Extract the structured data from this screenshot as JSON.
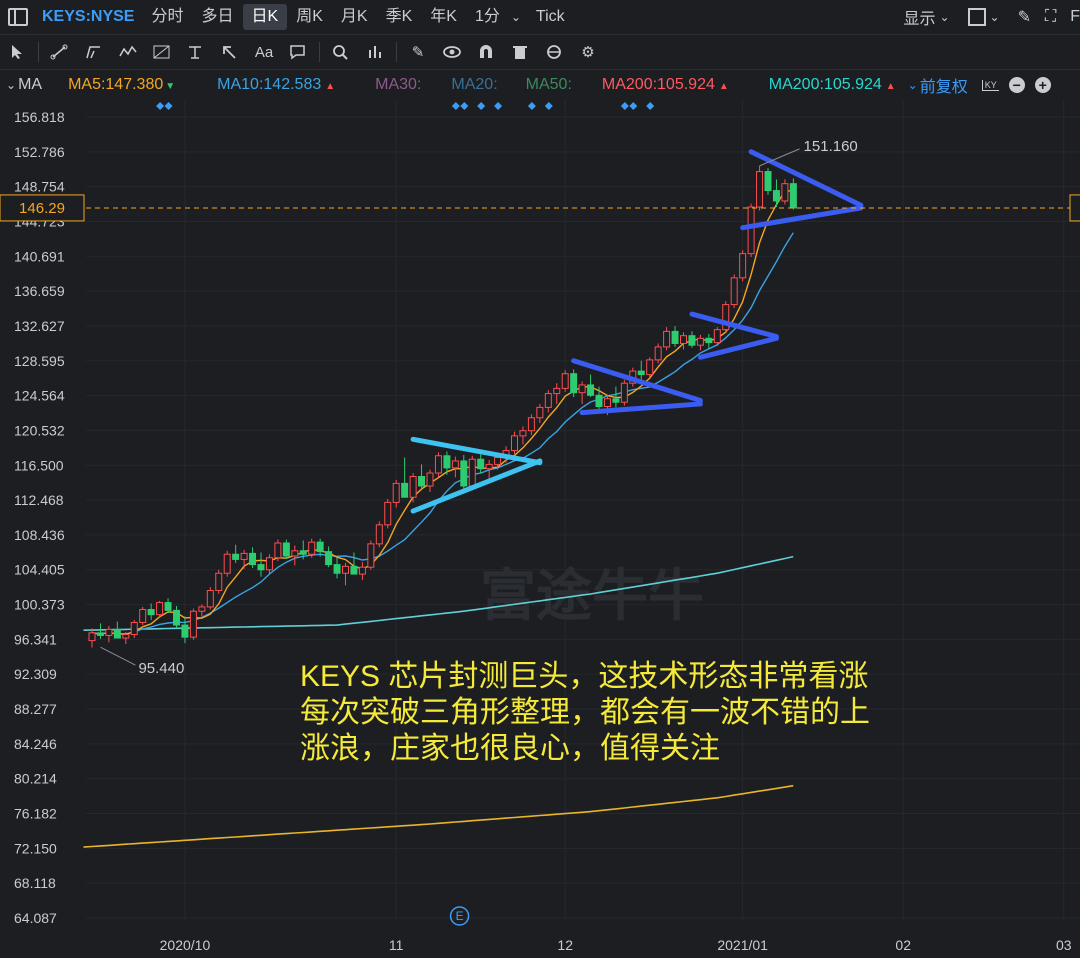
{
  "header": {
    "symbol": "KEYS:NYSE",
    "tabs": [
      "分时",
      "多日",
      "日K",
      "周K",
      "月K",
      "季K",
      "年K",
      "1分"
    ],
    "active_tab": "日K",
    "tick_label": "Tick",
    "display_label": "显示"
  },
  "toolbar": {
    "icons": [
      "cursor-icon",
      "line-draw-icon",
      "channel-draw-icon",
      "wave-draw-icon",
      "fib-draw-icon",
      "hline-draw-icon",
      "arrow-draw-icon",
      "text-tool-icon",
      "comment-icon",
      "zoom-icon",
      "pattern-icon",
      "pen-icon",
      "eye-icon",
      "magnet-icon",
      "trash-icon",
      "sync-icon",
      "settings-icon"
    ],
    "text_tool_label": "Aa"
  },
  "ma_legend": {
    "prefix": "MA",
    "items": [
      {
        "label": "MA5:147.380",
        "color": "#f5a623",
        "arrow": "▼",
        "arrow_color": "#2ecc71"
      },
      {
        "label": "MA10:142.583",
        "color": "#3aa3e3",
        "arrow": "▲",
        "arrow_color": "#ff4d4f"
      },
      {
        "label": "MA30:",
        "color": "#8e5a8c",
        "arrow": "",
        "arrow_color": ""
      },
      {
        "label": "MA20:",
        "color": "#3a6f96",
        "arrow": "",
        "arrow_color": ""
      },
      {
        "label": "MA50:",
        "color": "#3d8a5e",
        "arrow": "",
        "arrow_color": ""
      },
      {
        "label": "MA200:105.924",
        "color": "#ff5a5f",
        "arrow": "▲",
        "arrow_color": "#ff4d4f"
      },
      {
        "label": "MA200:105.924",
        "color": "#28d7d0",
        "arrow": "▲",
        "arrow_color": "#ff4d4f"
      }
    ],
    "adjust_label": "前复权",
    "kx_label": "KY"
  },
  "chart_data": {
    "type": "candlestick",
    "y_ticks": [
      156.818,
      152.786,
      148.754,
      144.723,
      140.691,
      136.659,
      132.627,
      128.595,
      124.564,
      120.532,
      116.5,
      112.468,
      108.436,
      104.405,
      100.373,
      96.341,
      92.309,
      88.277,
      84.246,
      80.214,
      76.182,
      72.15,
      68.118,
      64.087
    ],
    "ylim": [
      64.087,
      156.818
    ],
    "x_ticks": [
      {
        "label": "2020/10",
        "day": 11
      },
      {
        "label": "11",
        "day": 36
      },
      {
        "label": "12",
        "day": 56
      },
      {
        "label": "2021/01",
        "day": 77
      },
      {
        "label": "02",
        "day": 96
      },
      {
        "label": "03",
        "day": 115
      }
    ],
    "current_price": 146.29,
    "max_label": "151.160",
    "min_label": "95.440",
    "ohlc": [
      [
        96.2,
        97.6,
        95.4,
        97.1
      ],
      [
        97.1,
        98.2,
        96.4,
        96.8
      ],
      [
        96.8,
        97.9,
        96.0,
        97.5
      ],
      [
        97.5,
        98.4,
        96.9,
        96.5
      ],
      [
        96.5,
        97.2,
        95.8,
        96.9
      ],
      [
        96.9,
        98.6,
        96.5,
        98.3
      ],
      [
        98.3,
        100.1,
        98.0,
        99.8
      ],
      [
        99.8,
        100.5,
        98.6,
        99.2
      ],
      [
        99.2,
        100.8,
        98.9,
        100.6
      ],
      [
        100.6,
        101.1,
        99.4,
        99.7
      ],
      [
        99.7,
        100.2,
        97.6,
        98.0
      ],
      [
        98.0,
        99.0,
        95.9,
        96.6
      ],
      [
        96.6,
        99.9,
        96.3,
        99.6
      ],
      [
        99.6,
        100.4,
        99.0,
        100.1
      ],
      [
        100.1,
        102.4,
        99.8,
        102.0
      ],
      [
        102.0,
        104.4,
        101.6,
        104.0
      ],
      [
        104.0,
        106.6,
        103.6,
        106.2
      ],
      [
        106.2,
        107.3,
        105.2,
        105.6
      ],
      [
        105.6,
        106.7,
        104.5,
        106.3
      ],
      [
        106.3,
        107.0,
        104.6,
        105.0
      ],
      [
        105.0,
        106.4,
        103.6,
        104.4
      ],
      [
        104.4,
        106.2,
        103.9,
        105.8
      ],
      [
        105.8,
        107.9,
        105.4,
        107.5
      ],
      [
        107.5,
        107.9,
        105.7,
        106.0
      ],
      [
        106.0,
        107.2,
        104.9,
        106.6
      ],
      [
        106.6,
        107.8,
        105.6,
        106.2
      ],
      [
        106.2,
        108.0,
        105.8,
        107.6
      ],
      [
        107.6,
        108.0,
        105.9,
        106.5
      ],
      [
        106.5,
        107.1,
        104.7,
        105.0
      ],
      [
        105.0,
        105.8,
        103.4,
        104.0
      ],
      [
        104.0,
        105.2,
        102.6,
        104.8
      ],
      [
        104.8,
        106.4,
        104.2,
        103.9
      ],
      [
        103.9,
        105.3,
        103.2,
        104.7
      ],
      [
        104.7,
        107.8,
        104.4,
        107.4
      ],
      [
        107.4,
        110.0,
        107.0,
        109.6
      ],
      [
        109.6,
        112.6,
        109.2,
        112.2
      ],
      [
        112.2,
        114.8,
        111.6,
        114.4
      ],
      [
        114.4,
        117.4,
        113.9,
        112.8
      ],
      [
        112.8,
        115.6,
        112.2,
        115.2
      ],
      [
        115.2,
        116.6,
        113.6,
        114.1
      ],
      [
        114.1,
        116.0,
        113.4,
        115.6
      ],
      [
        115.6,
        118.0,
        115.1,
        117.6
      ],
      [
        117.6,
        118.1,
        115.4,
        116.2
      ],
      [
        116.2,
        117.5,
        115.1,
        117.0
      ],
      [
        117.0,
        117.7,
        113.7,
        114.1
      ],
      [
        114.1,
        117.6,
        113.6,
        117.2
      ],
      [
        117.2,
        118.0,
        115.6,
        116.1
      ],
      [
        116.1,
        117.1,
        114.9,
        116.6
      ],
      [
        116.6,
        117.7,
        116.0,
        117.4
      ],
      [
        117.4,
        118.7,
        116.8,
        118.2
      ],
      [
        118.2,
        120.4,
        117.8,
        119.9
      ],
      [
        119.9,
        121.0,
        118.9,
        120.5
      ],
      [
        120.5,
        122.4,
        120.0,
        122.0
      ],
      [
        122.0,
        123.6,
        121.4,
        123.2
      ],
      [
        123.2,
        125.2,
        122.6,
        124.8
      ],
      [
        124.8,
        126.0,
        123.6,
        125.4
      ],
      [
        125.4,
        127.5,
        125.0,
        127.1
      ],
      [
        127.1,
        127.6,
        124.4,
        124.9
      ],
      [
        124.9,
        126.2,
        123.6,
        125.8
      ],
      [
        125.8,
        127.0,
        124.4,
        124.6
      ],
      [
        124.6,
        125.6,
        122.8,
        123.3
      ],
      [
        123.3,
        124.7,
        122.3,
        124.2
      ],
      [
        124.2,
        125.6,
        123.2,
        123.8
      ],
      [
        123.8,
        126.4,
        123.4,
        126.0
      ],
      [
        126.0,
        127.8,
        125.6,
        127.4
      ],
      [
        127.4,
        128.6,
        126.2,
        127.0
      ],
      [
        127.0,
        129.0,
        126.6,
        128.7
      ],
      [
        128.7,
        130.6,
        128.3,
        130.2
      ],
      [
        130.2,
        132.5,
        129.8,
        132.0
      ],
      [
        132.0,
        132.6,
        130.2,
        130.6
      ],
      [
        130.6,
        131.9,
        129.9,
        131.5
      ],
      [
        131.5,
        132.0,
        130.1,
        130.4
      ],
      [
        130.4,
        131.6,
        129.8,
        131.2
      ],
      [
        131.2,
        131.7,
        130.0,
        130.7
      ],
      [
        130.7,
        132.5,
        130.3,
        132.2
      ],
      [
        132.2,
        135.5,
        131.8,
        135.1
      ],
      [
        135.1,
        138.6,
        134.7,
        138.2
      ],
      [
        138.2,
        141.4,
        137.8,
        141.0
      ],
      [
        141.0,
        146.8,
        140.6,
        146.4
      ],
      [
        146.4,
        151.16,
        146.0,
        150.5
      ],
      [
        150.5,
        150.9,
        147.8,
        148.3
      ],
      [
        148.3,
        149.6,
        146.4,
        147.1
      ],
      [
        147.1,
        149.6,
        146.7,
        149.1
      ],
      [
        149.1,
        149.7,
        146.1,
        146.29
      ]
    ],
    "ma200_upper": [
      [
        0,
        97.4
      ],
      [
        30,
        98.0
      ],
      [
        45,
        99.6
      ],
      [
        60,
        101.6
      ],
      [
        75,
        104.0
      ],
      [
        84,
        105.924
      ]
    ],
    "ma200_lower": [
      [
        0,
        72.3
      ],
      [
        20,
        73.6
      ],
      [
        40,
        74.9
      ],
      [
        60,
        76.4
      ],
      [
        75,
        78.0
      ],
      [
        84,
        79.4
      ]
    ],
    "annotation": {
      "lines": [
        "KEYS 芯片封测巨头，这技术形态非常看涨",
        "每次突破三角形整理，都会有一波不错的上",
        "涨浪，庄家也很良心，值得关注"
      ],
      "color": "#f5e93a"
    },
    "watermark": "富途牛牛",
    "event_marker": "E"
  }
}
